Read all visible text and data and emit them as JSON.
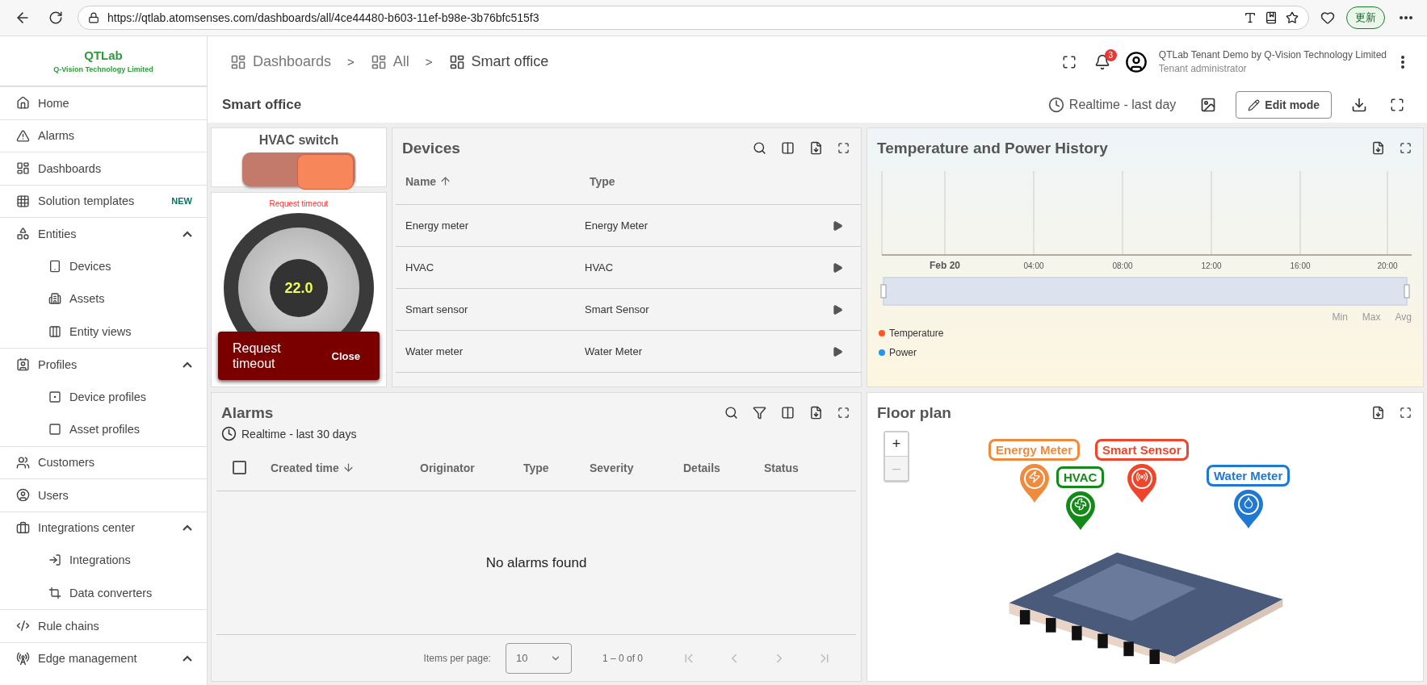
{
  "browser": {
    "url": "https://qtlab.atomsenses.com/dashboards/all/4ce44480-b603-11ef-b98e-3b76bfc515f3",
    "update_button": "更新"
  },
  "sidebar": {
    "logo": {
      "name": "QTLab",
      "subtitle": "Q-Vision Technology Limited"
    },
    "items": [
      {
        "label": "Home",
        "selected": false
      },
      {
        "label": "Alarms",
        "selected": false
      },
      {
        "label": "Dashboards",
        "selected": false
      },
      {
        "label": "Solution templates",
        "badge": "NEW",
        "selected": false
      },
      {
        "label": "Entities",
        "expanded": true,
        "selected": false,
        "children": [
          {
            "label": "Devices",
            "selected": false
          },
          {
            "label": "Assets",
            "selected": false
          },
          {
            "label": "Entity views",
            "selected": false
          }
        ]
      },
      {
        "label": "Profiles",
        "expanded": true,
        "selected": false,
        "children": [
          {
            "label": "Device profiles",
            "selected": false
          },
          {
            "label": "Asset profiles",
            "selected": false
          }
        ]
      },
      {
        "label": "Customers",
        "selected": false
      },
      {
        "label": "Users",
        "selected": false
      },
      {
        "label": "Integrations center",
        "expanded": true,
        "selected": false,
        "children": [
          {
            "label": "Integrations",
            "selected": false
          },
          {
            "label": "Data converters",
            "selected": false
          }
        ]
      },
      {
        "label": "Rule chains",
        "selected": false
      },
      {
        "label": "Edge management",
        "expanded": true,
        "selected": false
      }
    ]
  },
  "header": {
    "breadcrumbs": [
      "Dashboards",
      "All",
      "Smart office"
    ],
    "separator": ">",
    "notifications": "3",
    "user": {
      "name": "QTLab Tenant Demo by Q-Vision Technology Limited",
      "role": "Tenant administrator"
    }
  },
  "dashboard": {
    "title": "Smart office",
    "timewindow": "Realtime - last day",
    "edit_button": "Edit mode"
  },
  "hvac_switch": {
    "title": "HVAC switch",
    "on": true
  },
  "thermostat": {
    "status": "Request timeout",
    "value": "22.0"
  },
  "toast": {
    "message": "Request timeout",
    "action": "Close"
  },
  "devices": {
    "title": "Devices",
    "columns": [
      "Name",
      "Type"
    ],
    "rows": [
      {
        "name": "Energy meter",
        "type": "Energy Meter"
      },
      {
        "name": "HVAC",
        "type": "HVAC"
      },
      {
        "name": "Smart sensor",
        "type": "Smart Sensor"
      },
      {
        "name": "Water meter",
        "type": "Water Meter"
      }
    ]
  },
  "history": {
    "title": "Temperature and Power History",
    "ticks": [
      "Feb 20",
      "04:00",
      "08:00",
      "12:00",
      "16:00",
      "20:00"
    ],
    "stats": [
      "Min",
      "Max",
      "Avg"
    ],
    "range_selector": {
      "level": 1
    },
    "legend": [
      {
        "label": "Temperature",
        "color": "#ff5722"
      },
      {
        "label": "Power",
        "color": "#2196f3"
      }
    ]
  },
  "alarms": {
    "title": "Alarms",
    "select_all_checked": false,
    "timewindow": "Realtime - last 30 days",
    "columns": [
      "Created time",
      "Originator",
      "Type",
      "Severity",
      "Details",
      "Status"
    ],
    "empty": "No alarms found",
    "items_per_page_label": "Items per page:",
    "items_per_page": "10",
    "range": "1 – 0 of 0"
  },
  "floor_plan": {
    "title": "Floor plan",
    "zoom_in": "+",
    "zoom_out": "–",
    "markers": [
      {
        "label": "Energy Meter",
        "color": "#f08a3c"
      },
      {
        "label": "HVAC",
        "color": "#138a18"
      },
      {
        "label": "Smart Sensor",
        "color": "#f0452a"
      },
      {
        "label": "Water Meter",
        "color": "#1f78d1"
      }
    ]
  }
}
